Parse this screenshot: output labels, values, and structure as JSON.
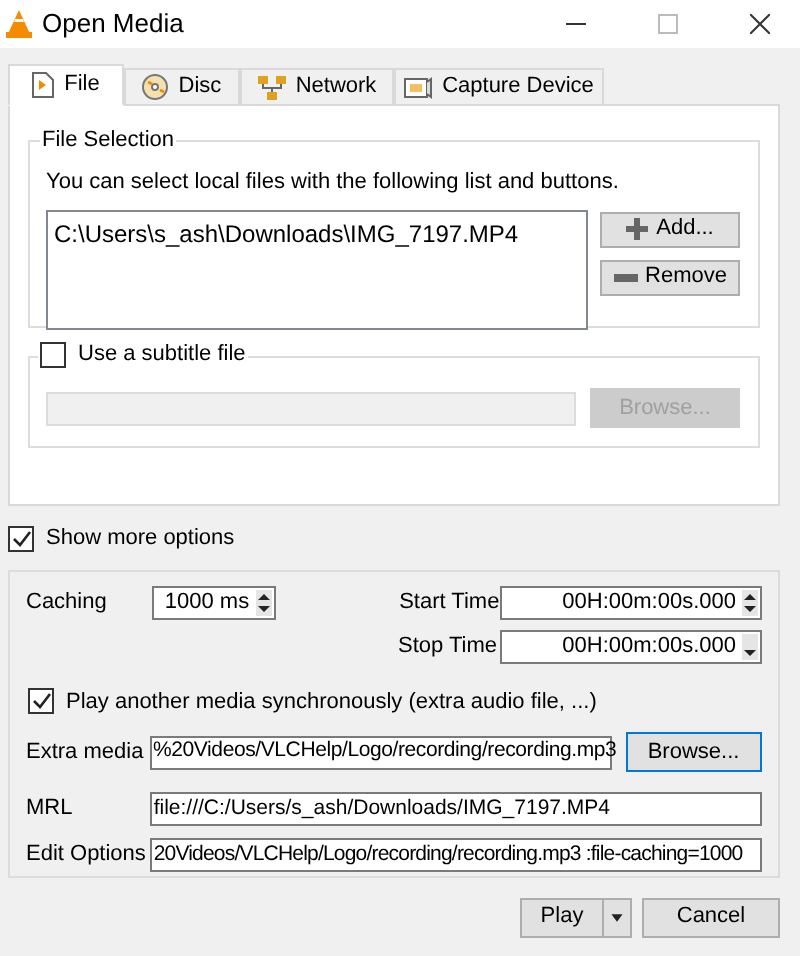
{
  "window": {
    "title": "Open Media"
  },
  "tabs": [
    {
      "label": "File",
      "selected": true
    },
    {
      "label": "Disc",
      "selected": false
    },
    {
      "label": "Network",
      "selected": false
    },
    {
      "label": "Capture Device",
      "selected": false
    }
  ],
  "file_selection": {
    "title": "File Selection",
    "hint": "You can select local files with the following list and buttons.",
    "files": [
      "C:\\Users\\s_ash\\Downloads\\IMG_7197.MP4"
    ],
    "add_button": "Add...",
    "remove_button": "Remove"
  },
  "subtitle": {
    "label": "Use a subtitle file",
    "checked": false,
    "browse_button": "Browse..."
  },
  "show_more_options": {
    "label": "Show more options",
    "checked": true
  },
  "options": {
    "caching": {
      "label": "Caching",
      "value": "1000 ms"
    },
    "start_time": {
      "label": "Start Time",
      "value": "00H:00m:00s.000"
    },
    "stop_time": {
      "label": "Stop Time",
      "value": "00H:00m:00s.000"
    },
    "sync": {
      "label": "Play another media synchronously (extra audio file, ...)",
      "checked": true
    },
    "extra_media": {
      "label": "Extra media",
      "value": "%20Videos/VLCHelp/Logo/recording/recording.mp3",
      "browse_button": "Browse..."
    },
    "mrl": {
      "label": "MRL",
      "value": "file:///C:/Users/s_ash/Downloads/IMG_7197.MP4"
    },
    "edit_options": {
      "label": "Edit Options",
      "value": "20Videos/VLCHelp/Logo/recording/recording.mp3 :file-caching=1000"
    }
  },
  "buttons": {
    "play": "Play",
    "cancel": "Cancel"
  }
}
